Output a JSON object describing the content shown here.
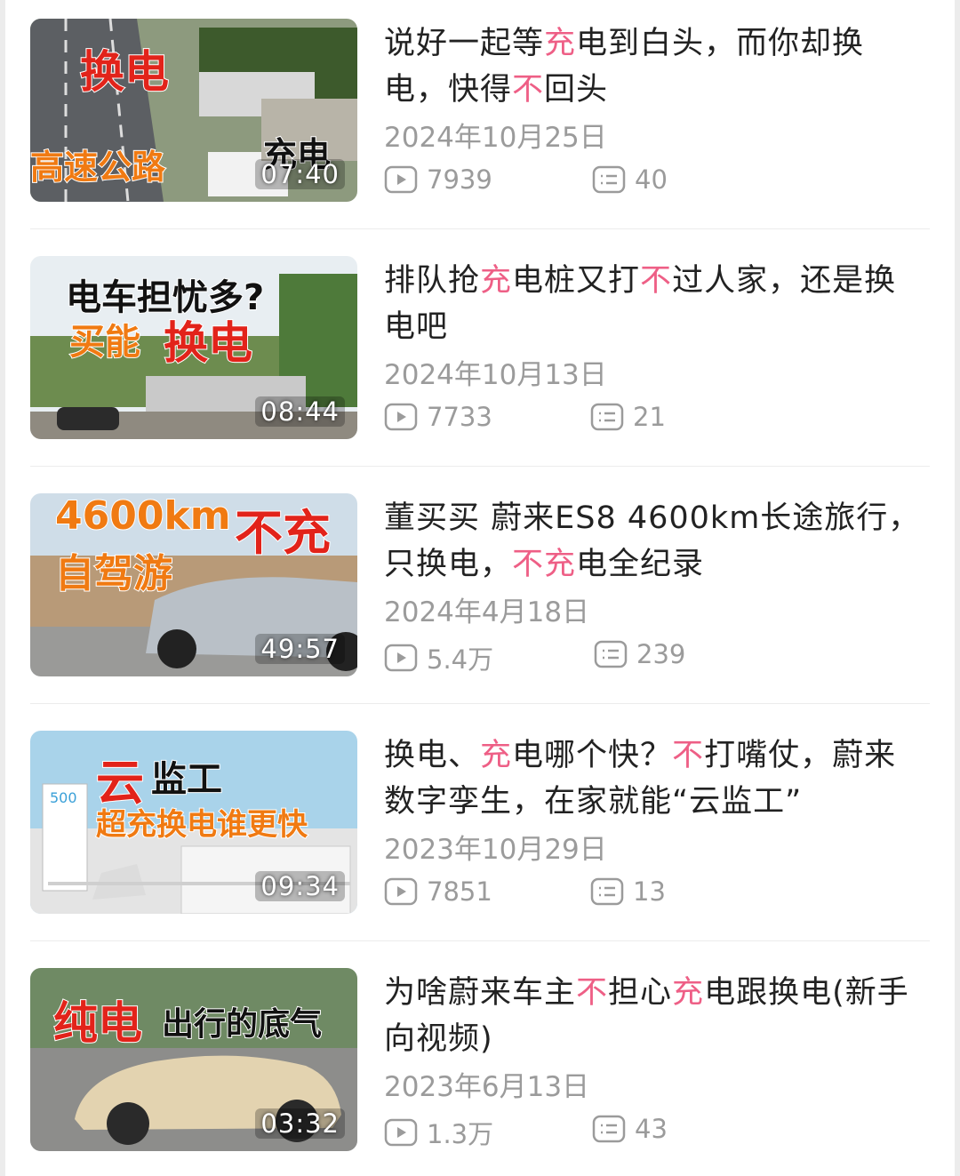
{
  "videos": [
    {
      "title_parts": [
        {
          "t": "说好一起等",
          "hl": false
        },
        {
          "t": "充",
          "hl": true
        },
        {
          "t": "电到白头，而你却换电，快得",
          "hl": false
        },
        {
          "t": "不",
          "hl": true
        },
        {
          "t": "回头",
          "hl": false
        }
      ],
      "date": "2024年10月25日",
      "duration": "07:40",
      "plays": "7939",
      "comments": "40",
      "overlay": [
        "换电",
        "高速公路",
        "充电"
      ]
    },
    {
      "title_parts": [
        {
          "t": "排队抢",
          "hl": false
        },
        {
          "t": "充",
          "hl": true
        },
        {
          "t": "电桩又打",
          "hl": false
        },
        {
          "t": "不",
          "hl": true
        },
        {
          "t": "过人家，还是换电吧",
          "hl": false
        }
      ],
      "date": "2024年10月13日",
      "duration": "08:44",
      "plays": "7733",
      "comments": "21",
      "overlay": [
        "电车担忧多?",
        "买能",
        "换电"
      ]
    },
    {
      "title_parts": [
        {
          "t": "董买买 蔚来ES8 4600km长途旅行，只换电，",
          "hl": false
        },
        {
          "t": "不充",
          "hl": true
        },
        {
          "t": "电全纪录",
          "hl": false
        }
      ],
      "date": "2024年4月18日",
      "duration": "49:57",
      "plays": "5.4万",
      "comments": "239",
      "overlay": [
        "4600km",
        "不充",
        "自驾游"
      ]
    },
    {
      "title_parts": [
        {
          "t": "换电、",
          "hl": false
        },
        {
          "t": "充",
          "hl": true
        },
        {
          "t": "电哪个快？",
          "hl": false
        },
        {
          "t": "不",
          "hl": true
        },
        {
          "t": "打嘴仗，蔚来数字孪生，在家就能“云监工”",
          "hl": false
        }
      ],
      "date": "2023年10月29日",
      "duration": "09:34",
      "plays": "7851",
      "comments": "13",
      "overlay": [
        "云",
        "监工",
        "超充换电谁更快",
        "500"
      ]
    },
    {
      "title_parts": [
        {
          "t": "为啥蔚来车主",
          "hl": false
        },
        {
          "t": "不",
          "hl": true
        },
        {
          "t": "担心",
          "hl": false
        },
        {
          "t": "充",
          "hl": true
        },
        {
          "t": "电跟换电(新手向视频)",
          "hl": false
        }
      ],
      "date": "2023年6月13日",
      "duration": "03:32",
      "plays": "1.3万",
      "comments": "43",
      "overlay": [
        "纯电",
        "出行的底气"
      ]
    }
  ],
  "colors": {
    "highlight": "#ee5f86",
    "meta": "#9b9b9b",
    "title": "#222222"
  },
  "icons": {
    "plays": "play-count-icon",
    "comments": "comment-count-icon"
  }
}
